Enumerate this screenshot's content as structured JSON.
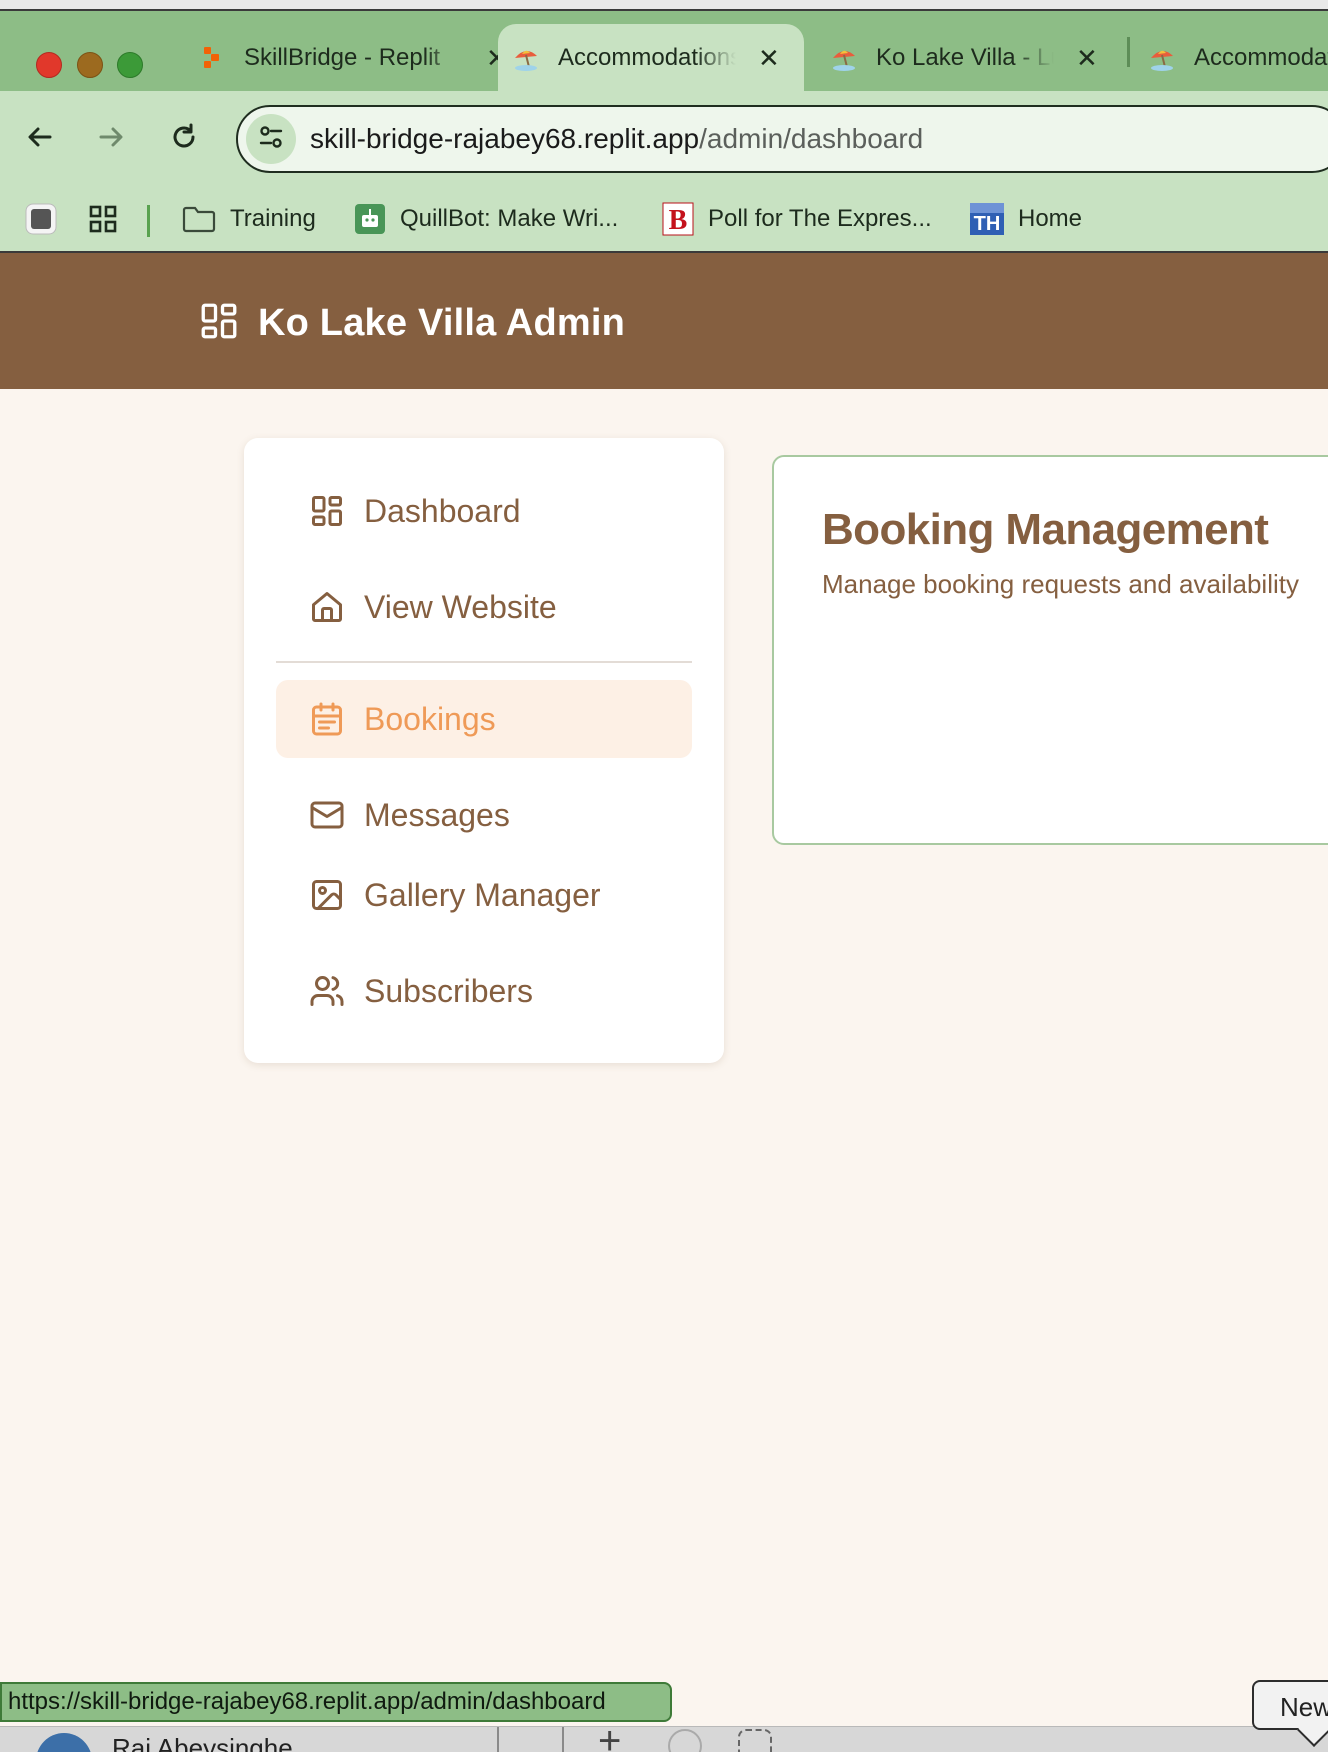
{
  "browser": {
    "tabs": [
      {
        "title": "SkillBridge - Replit",
        "favicon": "replit-icon",
        "close": "✕"
      },
      {
        "title": "Accommodations",
        "favicon": "beach-umbrella-icon",
        "close": "✕",
        "active": true
      },
      {
        "title": "Ko Lake Villa - Luxury",
        "favicon": "beach-umbrella-icon",
        "close": "✕"
      },
      {
        "title": "Accommodations",
        "favicon": "beach-umbrella-icon"
      }
    ],
    "url": {
      "host": "skill-bridge-rajabey68.replit.app",
      "path": "/admin/dashboard"
    },
    "bookmarks": [
      {
        "label": "",
        "icon": "app-square-icon"
      },
      {
        "label": "",
        "icon": "apps-grid-icon"
      },
      {
        "label": "Training",
        "icon": "folder-icon"
      },
      {
        "label": "QuillBot: Make Wri...",
        "icon": "quillbot-icon"
      },
      {
        "label": "Poll for The Expres...",
        "icon": "b-logo-icon"
      },
      {
        "label": "Home",
        "icon": "th-logo-icon"
      }
    ],
    "status_url": "https://skill-bridge-rajabey68.replit.app/admin/dashboard"
  },
  "header": {
    "title": "Ko Lake Villa Admin",
    "icon": "dashboard-grid-icon"
  },
  "sidebar": {
    "items": [
      {
        "label": "Dashboard",
        "icon": "dashboard-icon"
      },
      {
        "label": "View Website",
        "icon": "home-icon"
      },
      {
        "label": "Bookings",
        "icon": "calendar-icon",
        "active": true
      },
      {
        "label": "Messages",
        "icon": "mail-icon"
      },
      {
        "label": "Gallery Manager",
        "icon": "image-icon"
      },
      {
        "label": "Subscribers",
        "icon": "users-icon"
      }
    ]
  },
  "main": {
    "title": "Booking Management",
    "subtitle": "Manage booking requests and availability"
  },
  "taskbar": {
    "user_name": "Raj Abeysinghe",
    "tooltip": "New"
  },
  "colors": {
    "header_bg": "#855f40",
    "accent": "#ef9a57",
    "text_brown": "#855f40",
    "page_bg": "#fbf5ef",
    "chrome_green": "#8dbd86",
    "chrome_light_green": "#c8e2c2",
    "card_border": "#a8c9a0"
  }
}
